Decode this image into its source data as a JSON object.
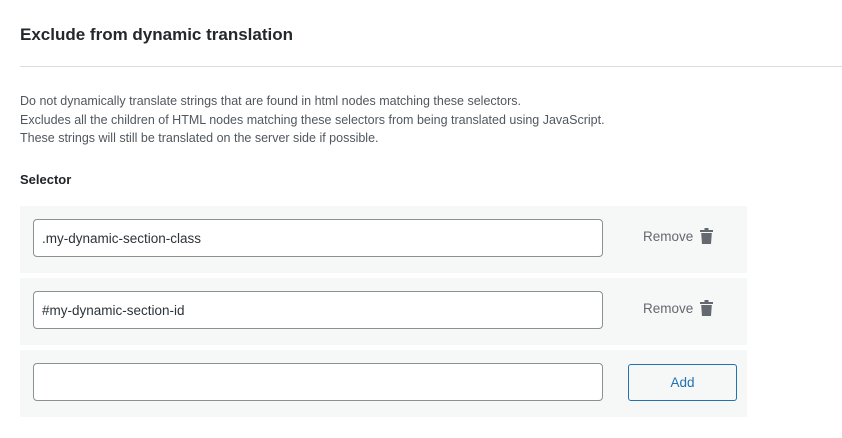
{
  "section": {
    "title": "Exclude from dynamic translation",
    "description": [
      "Do not dynamically translate strings that are found in html nodes matching these selectors.",
      "Excludes all the children of HTML nodes matching these selectors from being translated using JavaScript.",
      "These strings will still be translated on the server side if possible."
    ],
    "selector_label": "Selector"
  },
  "selectors": [
    {
      "value": ".my-dynamic-section-class",
      "remove_label": "Remove"
    },
    {
      "value": "#my-dynamic-section-id",
      "remove_label": "Remove"
    }
  ],
  "new_selector": {
    "value": "",
    "add_label": "Add"
  },
  "icons": {
    "remove": "trash-icon"
  },
  "colors": {
    "accent": "#2271b1",
    "row_bg": "#f6f7f7",
    "muted_text": "#646970"
  }
}
